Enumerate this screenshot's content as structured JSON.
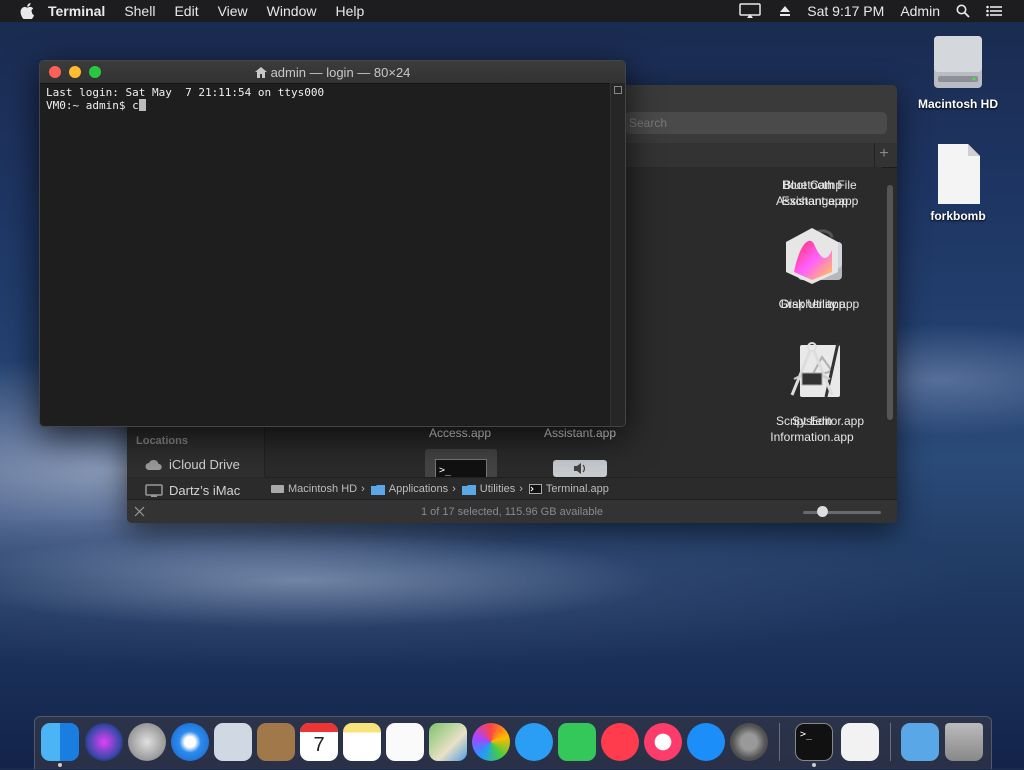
{
  "menubar": {
    "app_name": "Terminal",
    "items": [
      "Shell",
      "Edit",
      "View",
      "Window",
      "Help"
    ],
    "clock": "Sat 9:17 PM",
    "user": "Admin"
  },
  "desktop": {
    "icons": [
      {
        "label": "Macintosh HD"
      },
      {
        "label": "forkbomb"
      }
    ]
  },
  "finder": {
    "search_placeholder": "Search",
    "sidebar": {
      "locations_heading": "Locations",
      "items": [
        "iCloud Drive",
        "Dartz’s iMac"
      ]
    },
    "apps": [
      {
        "label": "Bluetooth File Exchange.app"
      },
      {
        "label": "Boot Camp Assistant.app"
      },
      {
        "label": "Disk Utility.app"
      },
      {
        "label": "Grapher.app"
      },
      {
        "label": "Script Editor.app"
      },
      {
        "label": "System Information.app"
      },
      {
        "label": "Access.app"
      },
      {
        "label": "Assistant.app"
      }
    ],
    "path": [
      "Macintosh HD",
      "Applications",
      "Utilities",
      "Terminal.app"
    ],
    "status": "1 of 17 selected, 115.96 GB available"
  },
  "terminal": {
    "title": "admin — login — 80×24",
    "line1": "Last login: Sat May  7 21:11:54 on ttys000",
    "prompt": "VM0:~ admin$ ",
    "input": "c"
  },
  "colors": {
    "close": "#fe5f57",
    "minimize": "#febc2e",
    "zoom": "#28c840"
  }
}
